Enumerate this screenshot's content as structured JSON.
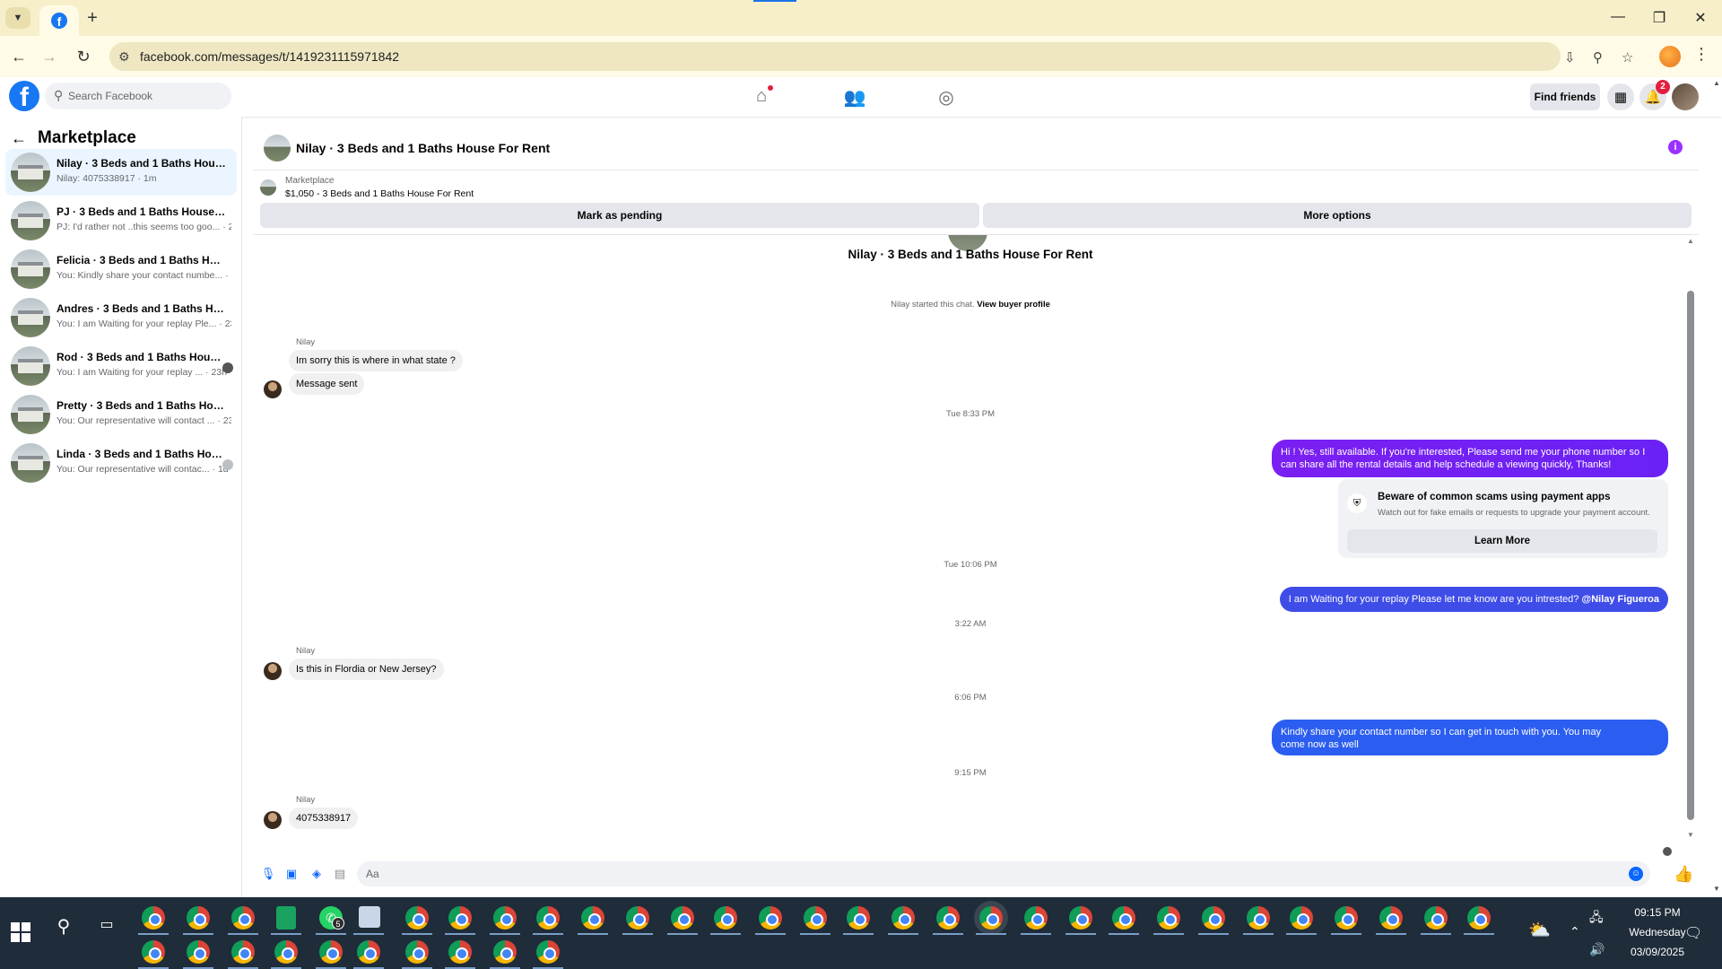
{
  "browser": {
    "url": "facebook.com/messages/t/1419231115971842"
  },
  "fb_header": {
    "search_placeholder": "Search Facebook",
    "find_friends": "Find friends",
    "notif_count": "2"
  },
  "sidebar": {
    "title": "Marketplace",
    "conversations": [
      {
        "name": "Nilay · 3 Beds and 1 Baths House F...",
        "sub": "Nilay: 4075338917 · 1m"
      },
      {
        "name": "PJ · 3 Beds and 1 Baths House For ...",
        "sub": "PJ: I'd rather not ..this seems too goo... · 2h"
      },
      {
        "name": "Felicia · 3 Beds and 1 Baths House ...",
        "sub": "You: Kindly share your contact numbe... · 3h"
      },
      {
        "name": "Andres · 3 Beds and 1 Baths House...",
        "sub": "You: I am Waiting for your replay Ple... · 23h"
      },
      {
        "name": "Rod · 3 Beds and 1 Baths House ...",
        "sub": "You: I am Waiting for your replay ... · 23h"
      },
      {
        "name": "Pretty · 3 Beds and 1 Baths House ...",
        "sub": "You: Our representative will contact ... · 23h"
      },
      {
        "name": "Linda · 3 Beds and 1 Baths Hous...",
        "sub": "You: Our representative will contac... · 1d"
      }
    ]
  },
  "chat": {
    "title": "Nilay · 3 Beds and 1 Baths House For Rent",
    "listing_label": "Marketplace",
    "listing_price": "$1,050 - 3 Beds and 1 Baths House For Rent",
    "mark_pending": "Mark as pending",
    "more_options": "More options",
    "started_text": "Nilay started this chat.",
    "view_profile": "View buyer profile",
    "sender_name": "Nilay",
    "msg_in_1": "Im sorry this is where in what state ?",
    "msg_in_2": "Message sent",
    "ts_1": "Tue 8:33 PM",
    "msg_out_1_line1": "Hi ! Yes, still available. If you're interested, Please send me your phone number so I",
    "msg_out_1_line2": "can share all the rental details and help schedule a viewing quickly, Thanks!",
    "scam_title": "Beware of common scams using payment apps",
    "scam_text": "Watch out for fake emails or requests to upgrade your payment account.",
    "scam_btn": "Learn More",
    "ts_2": "Tue 10:06 PM",
    "msg_out_2": "I am Waiting for your replay Please let me know are you intrested?",
    "msg_out_2_mention": "@Nilay Figueroa",
    "ts_3": "3:22 AM",
    "msg_in_3": "Is this in Flordia or New Jersey?",
    "ts_4": "6:06 PM",
    "msg_out_3_line1": "Kindly share your contact number so I can get in touch with you. You may",
    "msg_out_3_line2": "come now as well",
    "ts_5": "9:15 PM",
    "msg_in_4": "4075338917",
    "composer_placeholder": "Aa"
  },
  "taskbar": {
    "time": "09:15 PM",
    "day": "Wednesday",
    "date": "03/09/2025",
    "whatsapp_badge": "5"
  },
  "colors": {
    "fb_blue": "#1877f2",
    "outgoing_purple": "#6b25f5",
    "outgoing_blue": "#2b5ef0",
    "chrome_tab": "#f6efc9",
    "taskbar": "#1f2c3a"
  }
}
